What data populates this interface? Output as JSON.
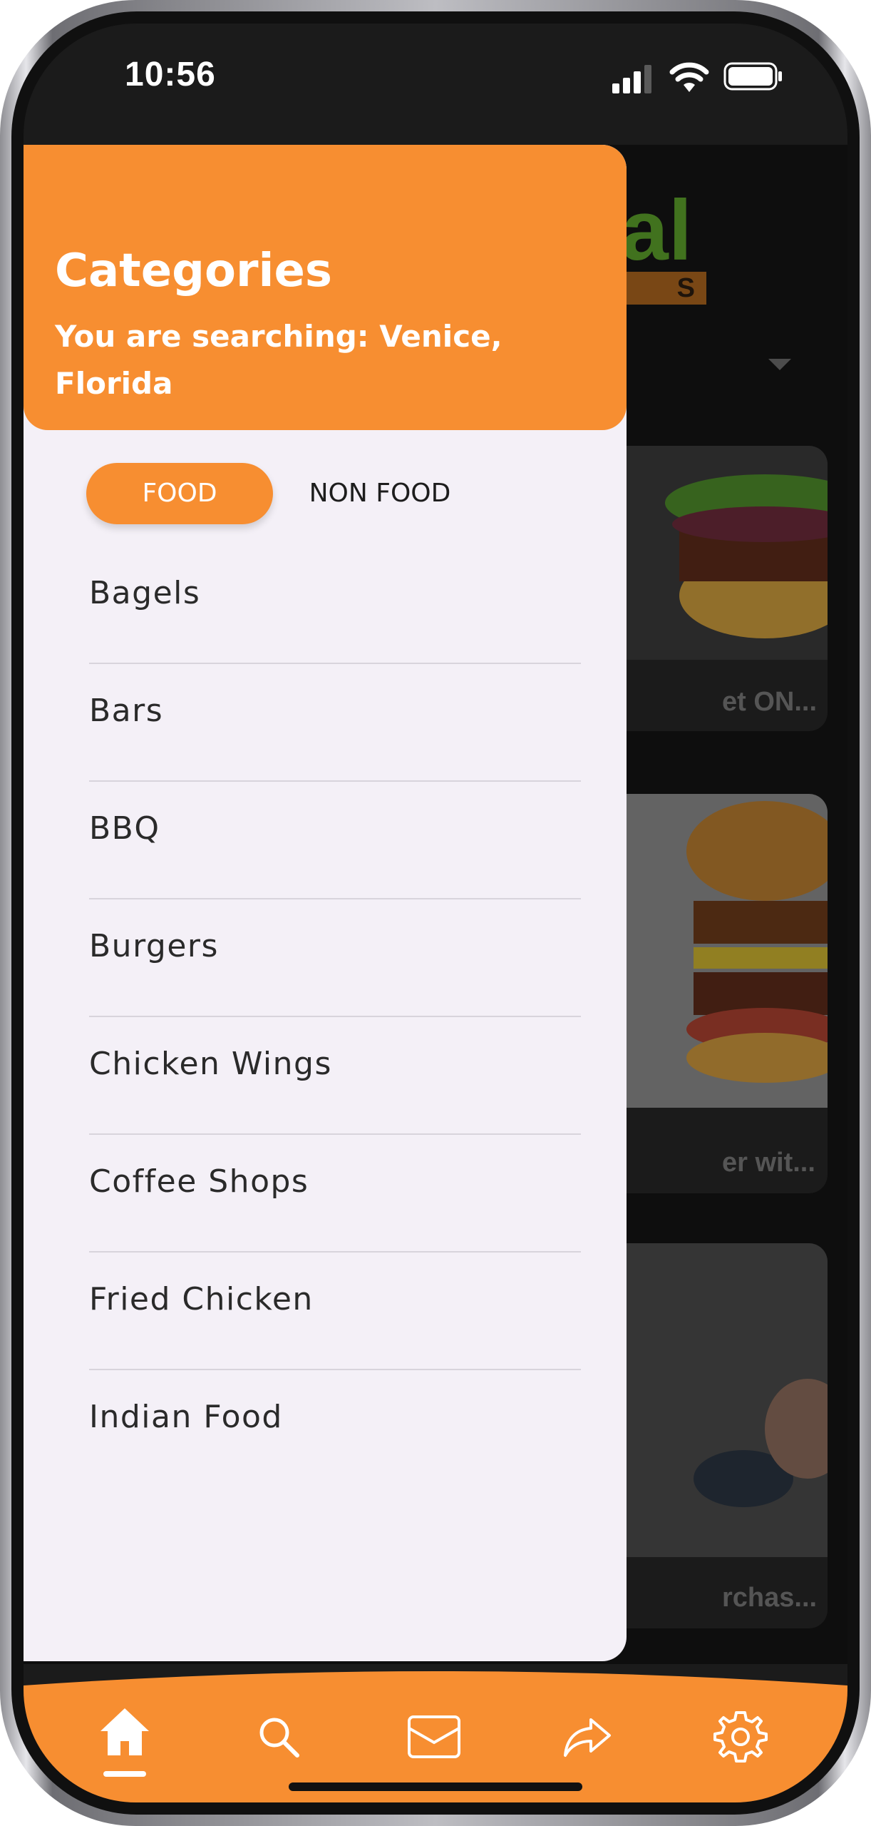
{
  "status_bar": {
    "time": "10:56"
  },
  "background": {
    "logo_text": "al",
    "logo_badge": "S",
    "cards": [
      {
        "title": "et ON..."
      },
      {
        "title": "er wit..."
      },
      {
        "title": "rchas..."
      }
    ]
  },
  "drawer": {
    "title": "Categories",
    "subtitle": "You are searching: Venice, Florida",
    "tabs": [
      {
        "label": "FOOD",
        "active": true
      },
      {
        "label": "NON FOOD",
        "active": false
      }
    ],
    "categories": [
      {
        "label": "Bagels"
      },
      {
        "label": "Bars"
      },
      {
        "label": "BBQ"
      },
      {
        "label": "Burgers"
      },
      {
        "label": "Chicken Wings"
      },
      {
        "label": "Coffee Shops"
      },
      {
        "label": "Fried Chicken"
      },
      {
        "label": "Indian Food"
      }
    ]
  },
  "bottom_nav": {
    "items": [
      {
        "icon": "home-icon",
        "active": true
      },
      {
        "icon": "search-icon",
        "active": false
      },
      {
        "icon": "mail-icon",
        "active": false
      },
      {
        "icon": "share-icon",
        "active": false
      },
      {
        "icon": "gear-icon",
        "active": false
      }
    ]
  },
  "colors": {
    "accent": "#f78e31",
    "drawer_bg": "#f4f0f7",
    "logo_green": "#5a9e2a"
  }
}
